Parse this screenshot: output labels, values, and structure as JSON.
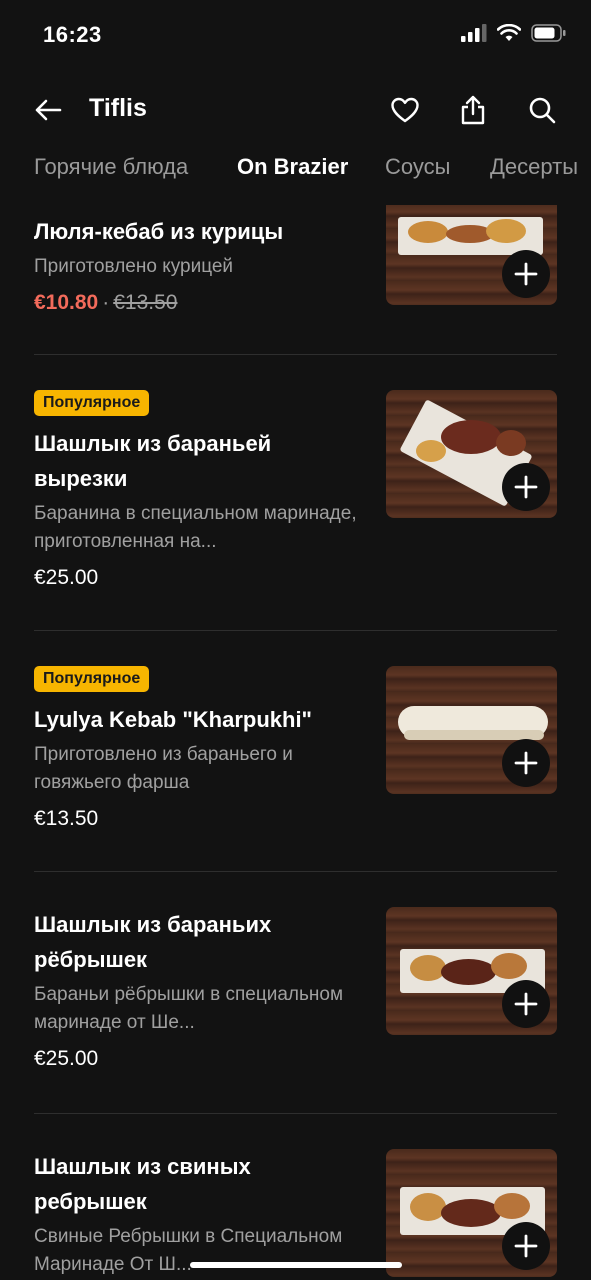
{
  "status": {
    "time": "16:23"
  },
  "header": {
    "title": "Tiflis"
  },
  "tabs": [
    {
      "label": "Горячие блюда"
    },
    {
      "label": "On Brazier"
    },
    {
      "label": "Соусы"
    },
    {
      "label": "Десерты"
    }
  ],
  "items": [
    {
      "name": "Люля-кебаб из курицы",
      "description": "Приготовлено курицей",
      "price_sale": "€10.80",
      "price_sep": "·",
      "price_old": "€13.50"
    },
    {
      "badge": "Популярное",
      "name": "Шашлык из бараньей вырезки",
      "description": "Баранина в специальном маринаде, приготовленная на...",
      "price": "€25.00"
    },
    {
      "badge": "Популярное",
      "name": "Lyulya Kebab \"Kharpukhi\"",
      "description": "Приготовлено из бараньего и говяжьего фарша",
      "price": "€13.50"
    },
    {
      "name": "Шашлык из бараньих рёбрышек",
      "description": "Бараньи рёбрышки в специальном маринаде от Ше...",
      "price": "€25.00"
    },
    {
      "name": "Шашлык из свиных ребрышек",
      "description": "Свиные Ребрышки в Специальном Маринаде От Ш..."
    }
  ]
}
